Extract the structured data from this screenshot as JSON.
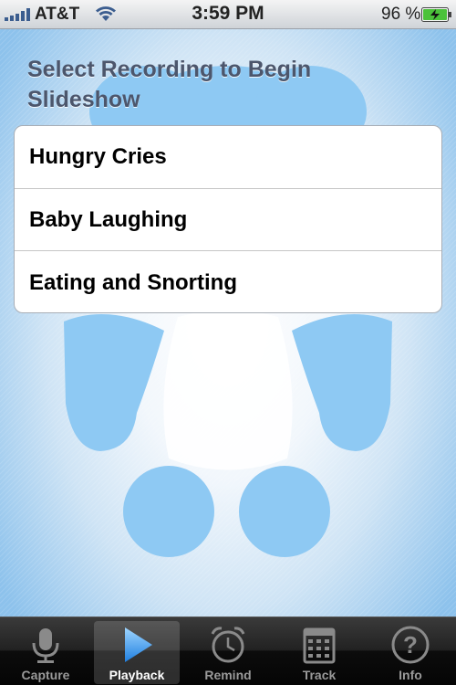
{
  "status_bar": {
    "carrier": "AT&T",
    "time": "3:59 PM",
    "battery": "96 %",
    "signal_icon": "signal-bars-icon",
    "wifi_icon": "wifi-icon",
    "battery_icon": "battery-charging-icon"
  },
  "main": {
    "title": "Select Recording to Begin Slideshow",
    "recordings": [
      {
        "label": "Hungry Cries"
      },
      {
        "label": "Baby Laughing"
      },
      {
        "label": "Eating and Snorting"
      }
    ],
    "background_art": "baby-silhouette",
    "colors": {
      "art": "#8ec9f3",
      "title": "#4c566c"
    }
  },
  "tab_bar": {
    "selected": "Playback",
    "tabs": [
      {
        "label": "Capture",
        "icon": "microphone-icon"
      },
      {
        "label": "Playback",
        "icon": "play-icon"
      },
      {
        "label": "Remind",
        "icon": "alarm-clock-icon"
      },
      {
        "label": "Track",
        "icon": "calendar-icon"
      },
      {
        "label": "Info",
        "icon": "question-icon"
      }
    ]
  }
}
